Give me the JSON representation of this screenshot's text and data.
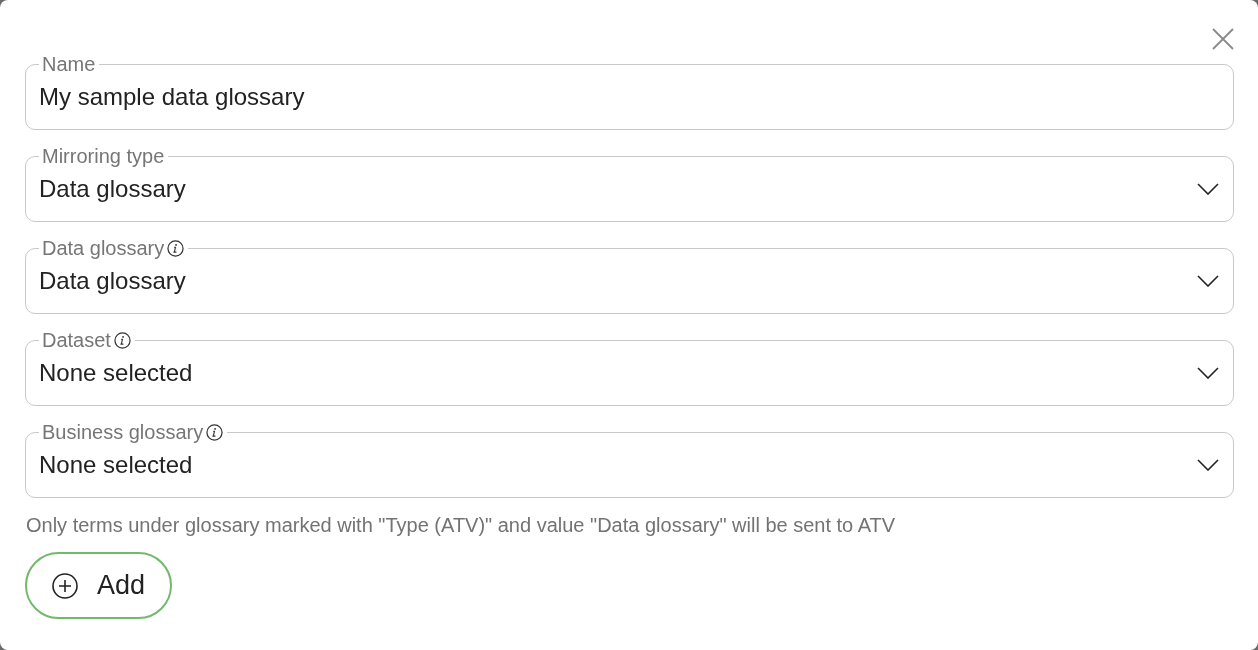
{
  "dialog": {
    "fields": [
      {
        "kind": "text",
        "label": "Name",
        "info": false,
        "value": "My sample data glossary"
      },
      {
        "kind": "select",
        "label": "Mirroring type",
        "info": false,
        "value": "Data glossary"
      },
      {
        "kind": "select",
        "label": "Data glossary",
        "info": true,
        "value": "Data glossary"
      },
      {
        "kind": "select",
        "label": "Dataset",
        "info": true,
        "value": "None selected"
      },
      {
        "kind": "select",
        "label": "Business glossary",
        "info": true,
        "value": "None selected"
      }
    ],
    "note": "Only terms under glossary marked with \"Type (ATV)\" and value \"Data glossary\" will be sent to ATV",
    "add_button": {
      "label": "Add"
    }
  }
}
